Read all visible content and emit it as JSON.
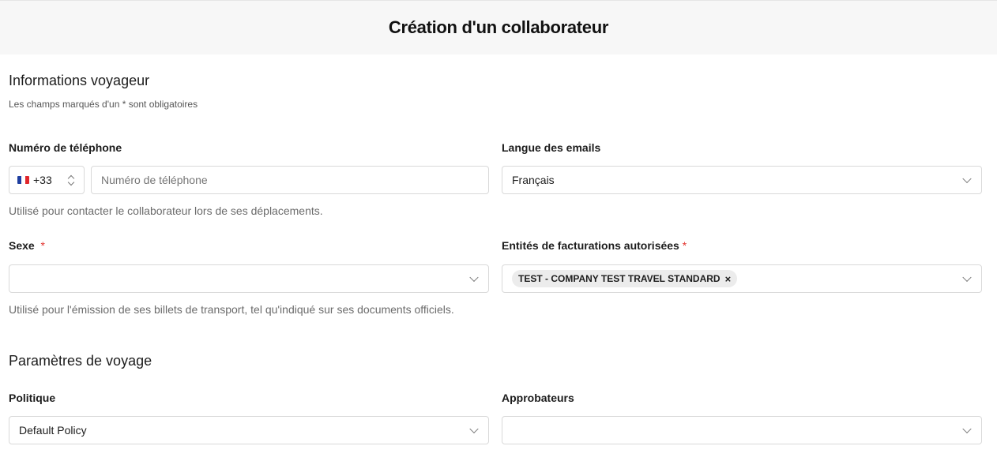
{
  "page": {
    "title": "Création d'un collaborateur"
  },
  "traveler_section": {
    "title": "Informations voyageur",
    "required_hint": "Les champs marqués d'un * sont obligatoires"
  },
  "phone": {
    "label": "Numéro de téléphone",
    "country_code": "+33",
    "country_flag": "flag-france-icon",
    "placeholder": "Numéro de téléphone",
    "value": "",
    "helper": "Utilisé pour contacter le collaborateur lors de ses déplacements."
  },
  "email_language": {
    "label": "Langue des emails",
    "value": "Français"
  },
  "gender": {
    "label": "Sexe",
    "required_mark": "*",
    "value": "",
    "helper": "Utilisé pour l'émission de ses billets de transport, tel qu'indiqué sur ses documents officiels."
  },
  "billing_entities": {
    "label": "Entités de facturations autorisées",
    "required_mark": "*",
    "chips": [
      {
        "label": "TEST - COMPANY TEST TRAVEL STANDARD",
        "remove_icon": "×"
      }
    ]
  },
  "travel_section": {
    "title": "Paramètres de voyage"
  },
  "policy": {
    "label": "Politique",
    "value": "Default Policy"
  },
  "approvers": {
    "label": "Approbateurs",
    "value": ""
  },
  "colors": {
    "required": "#e2342f",
    "header_bg": "#f7f7f7",
    "border": "#d9d9d9",
    "chip_bg": "#ececec"
  }
}
